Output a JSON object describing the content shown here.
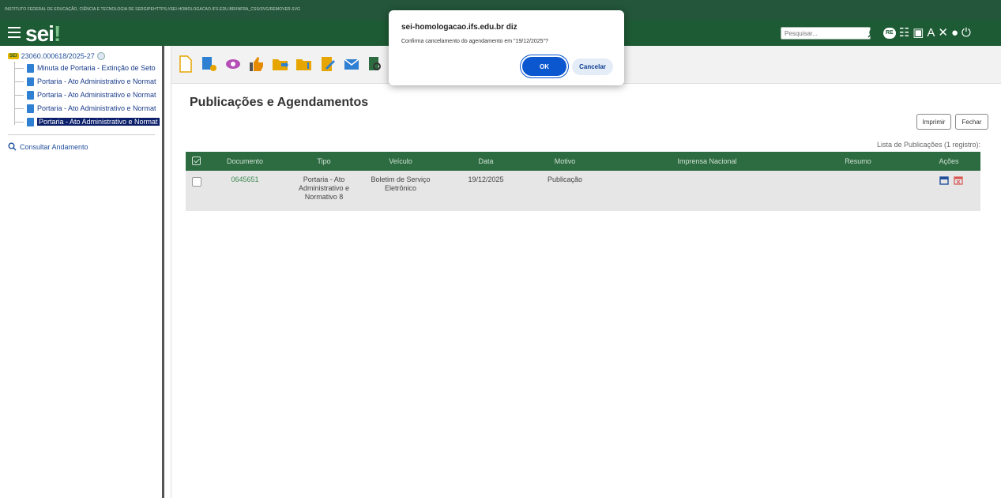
{
  "header": {
    "institution": "INSTITUTO FEDERAL DE EDUCAÇÃO, CIÊNCIA E TECNOLOGIA DE SERGIPEHTTPS://SEI-HOMOLOGACAO.IFS.EDU.BR/INFRA_CSS/SVG/REMOVER.SVG",
    "logo": "sei",
    "logo_dot": "!",
    "search_placeholder": "Pesquisar...",
    "re_badge": "RE"
  },
  "tree": {
    "process": "23060.000618/2025-27",
    "sei_badge": "SEI",
    "items": [
      {
        "label": "Minuta de Portaria - Extinção de Seto"
      },
      {
        "label": "Portaria - Ato Administrativo e Normat"
      },
      {
        "label": "Portaria - Ato Administrativo e Normat"
      },
      {
        "label": "Portaria - Ato Administrativo e Normat"
      },
      {
        "label": "Portaria - Ato Administrativo e Normat"
      }
    ],
    "consultar": "Consultar Andamento"
  },
  "main": {
    "title": "Publicações e Agendamentos",
    "print_button": "Imprimir",
    "close_button": "Fechar",
    "list_caption": "Lista de Publicações (1 registro):",
    "columns": [
      "Documento",
      "Tipo",
      "Veículo",
      "Data",
      "Motivo",
      "Imprensa Nacional",
      "Resumo",
      "Ações"
    ],
    "rows": [
      {
        "documento": "0645651",
        "tipo": [
          "Portaria - Ato",
          "Administrativo e",
          "Normativo 8"
        ],
        "veiculo": [
          "Boletim de Serviço",
          "Eletrônico"
        ],
        "data": "19/12/2025",
        "motivo": "Publicação",
        "imprensa": "",
        "resumo": ""
      }
    ]
  },
  "dialog": {
    "title": "sei-homologacao.ifs.edu.br diz",
    "message": "Confirma cancelamento do agendamento em \"19/12/2025\"?",
    "ok": "OK",
    "cancel": "Cancelar"
  }
}
